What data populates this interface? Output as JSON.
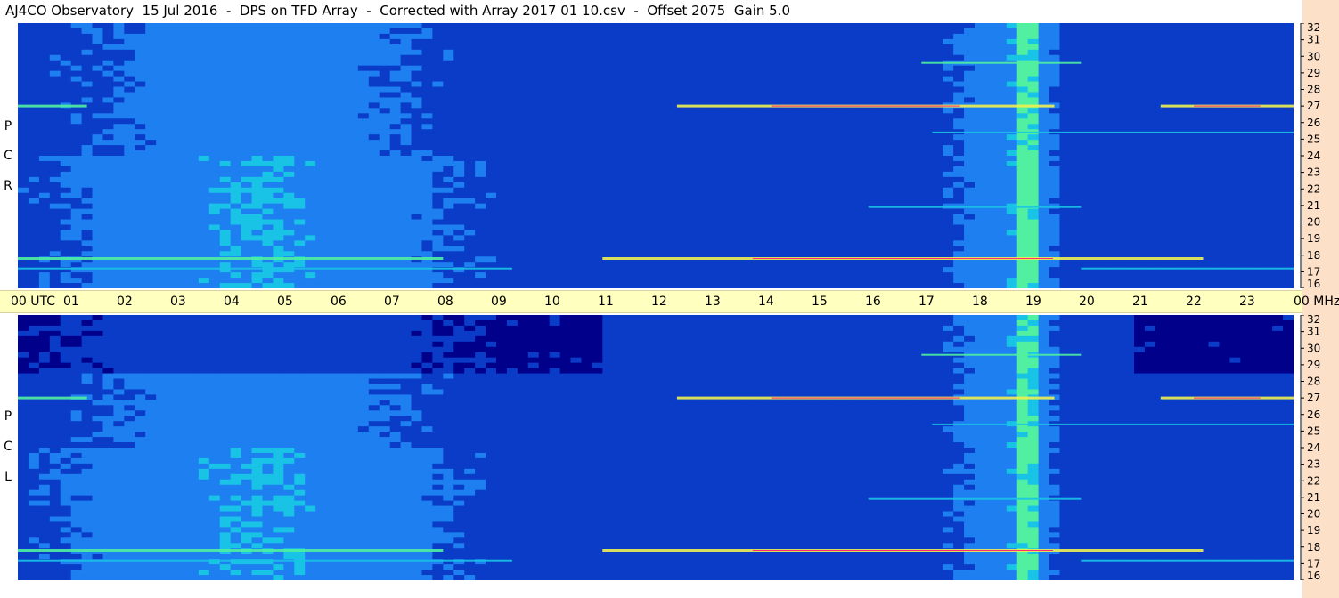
{
  "title": "AJ4CO Observatory  15 Jul 2016  -  DPS on TFD Array  -  Corrected with Array 2017 01 10.csv  -  Offset 2075  Gain 5.0",
  "panels": [
    {
      "id": "top",
      "letters": [
        "R",
        "C",
        "P"
      ]
    },
    {
      "id": "bottom",
      "letters": [
        "L",
        "C",
        "P"
      ]
    }
  ],
  "time_axis": {
    "ticks": [
      "00",
      "01",
      "02",
      "03",
      "04",
      "05",
      "06",
      "07",
      "08",
      "09",
      "10",
      "11",
      "12",
      "13",
      "14",
      "15",
      "16",
      "17",
      "18",
      "19",
      "20",
      "21",
      "22",
      "23",
      "00"
    ],
    "first_unit": "UTC",
    "last_unit": "MHz"
  },
  "chart_data": {
    "type": "heatmap",
    "title": "AJ4CO Observatory  15 Jul 2016  -  DPS on TFD Array  -  Corrected with Array 2017 01 10.csv  -  Offset 2075  Gain 5.0",
    "xlabel": "UTC",
    "ylabel": "MHz",
    "x_ticks": [
      "00",
      "01",
      "02",
      "03",
      "04",
      "05",
      "06",
      "07",
      "08",
      "09",
      "10",
      "11",
      "12",
      "13",
      "14",
      "15",
      "16",
      "17",
      "18",
      "19",
      "20",
      "21",
      "22",
      "23",
      "00"
    ],
    "xlim": [
      0,
      24
    ],
    "ylim": [
      16,
      32
    ],
    "y_ticks": [
      32,
      31,
      30,
      29,
      28,
      27,
      26,
      25,
      24,
      23,
      22,
      21,
      20,
      19,
      18,
      17,
      16
    ],
    "panels": [
      "RCP",
      "LCP"
    ],
    "colormap": [
      "#00008b",
      "#0a3cc8",
      "#1e7ff0",
      "#19c3e6",
      "#50f0a0",
      "#f0f050",
      "#ff9a2a",
      "#ff2d78",
      "#ffffff"
    ]
  }
}
